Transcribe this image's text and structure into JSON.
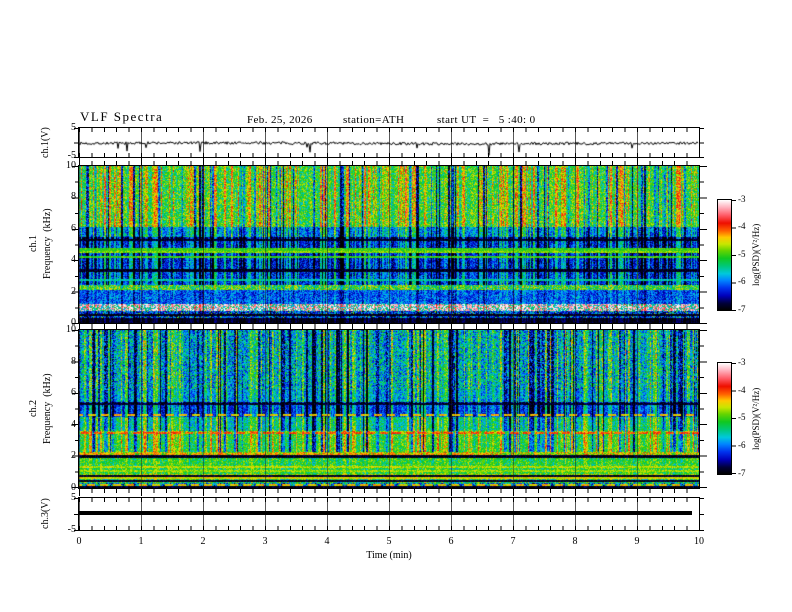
{
  "header": {
    "title": "VLF Spectra",
    "date": "Feb. 25, 2026",
    "station": "station=ATH",
    "start_ut": "start UT  =   5 :40: 0"
  },
  "x_axis": {
    "label": "Time  (min)",
    "ticks": [
      "0",
      "1",
      "2",
      "3",
      "4",
      "5",
      "6",
      "7",
      "8",
      "9",
      "10"
    ],
    "range_min": [
      0,
      10
    ]
  },
  "panels": {
    "ch1_wave": {
      "ylabel": "ch.1(V)",
      "ytick_top": "5",
      "ytick_bottom": "-5"
    },
    "spec1": {
      "channel": "ch.1",
      "ylabel": "Frequency  (kHz)",
      "yticks": [
        "10",
        "8",
        "6",
        "4",
        "2",
        "0"
      ]
    },
    "spec2": {
      "channel": "ch.2",
      "ylabel": "Frequency  (kHz)",
      "yticks": [
        "10",
        "8",
        "6",
        "4",
        "2",
        "0"
      ]
    },
    "ch3_wave": {
      "ylabel": "ch.3(V)",
      "ytick_top": "5",
      "ytick_bottom": "-5"
    }
  },
  "colorbar": {
    "label": "log(PSD)(V²/Hz)",
    "ticks": [
      "-3",
      "-4",
      "-5",
      "-6",
      "-7"
    ],
    "range": [
      -7,
      -3
    ],
    "stops": [
      [
        0.0,
        "#000000"
      ],
      [
        0.06,
        "#000038"
      ],
      [
        0.13,
        "#0000bb"
      ],
      [
        0.2,
        "#0033ee"
      ],
      [
        0.27,
        "#0086ff"
      ],
      [
        0.33,
        "#00c8dd"
      ],
      [
        0.4,
        "#00c878"
      ],
      [
        0.47,
        "#10c820"
      ],
      [
        0.54,
        "#66d400"
      ],
      [
        0.6,
        "#c8e600"
      ],
      [
        0.66,
        "#ffc800"
      ],
      [
        0.72,
        "#ff6000"
      ],
      [
        0.79,
        "#ee0f00"
      ],
      [
        0.86,
        "#ff5a66"
      ],
      [
        0.93,
        "#ffaebb"
      ],
      [
        1.0,
        "#ffffff"
      ]
    ]
  },
  "chart_data": [
    {
      "type": "line",
      "name": "ch.1 time series",
      "ylabel": "ch.1(V)",
      "ylim": [
        -5,
        5
      ],
      "xlim_min": [
        0,
        10
      ],
      "baseline_v": -0.3,
      "noise_amplitude_v": 0.9,
      "spike_amplitude_v": 4,
      "description": "continuous noisy trace near 0 V with intermittent impulsive spikes up to ±4 V"
    },
    {
      "type": "heatmap",
      "name": "ch.1 spectrogram",
      "xlabel": "Time  (min)",
      "ylabel": "Frequency  (kHz)",
      "xlim_min": [
        0,
        10
      ],
      "ylim": [
        0,
        10
      ],
      "zlabel": "log(PSD)(V²/Hz)",
      "zlim": [
        -7,
        -3
      ],
      "bands": [
        {
          "f": [
            0,
            0.35
          ],
          "psd": -6.9,
          "noise": 0.15
        },
        {
          "f": [
            0.35,
            0.78
          ],
          "psd": -6.3,
          "noise": 0.6,
          "speckle": {
            "frac": 0.1,
            "psd": -5.0
          }
        },
        {
          "f": [
            0.78,
            1.2
          ],
          "psd": -3.3,
          "noise": 0.25,
          "speckle": {
            "frac": 0.4,
            "psd": -5.5
          }
        },
        {
          "f": [
            1.2,
            2.1
          ],
          "psd": -6.1,
          "noise": 0.45
        },
        {
          "f": [
            2.1,
            2.45
          ],
          "psd": -5.1,
          "noise": 0.7
        },
        {
          "f": [
            2.45,
            3.3
          ],
          "psd": -6.3,
          "noise": 0.45
        },
        {
          "f": [
            3.3,
            5.25
          ],
          "psd": -6.4,
          "noise": 0.45
        },
        {
          "f": [
            5.25,
            5.5
          ],
          "psd": -6.8,
          "noise": 0.25
        },
        {
          "f": [
            5.5,
            6.1
          ],
          "psd": -6.0,
          "noise": 0.5
        },
        {
          "f": [
            6.1,
            10
          ],
          "psd": -5.15,
          "noise": 0.6
        }
      ],
      "hlines": [
        {
          "f": 4.2,
          "psd": -5.0
        },
        {
          "f": 4.5,
          "psd": -4.8
        },
        {
          "f": 4.68,
          "psd": -5.0
        },
        {
          "f": 3.35,
          "psd": -6.9
        },
        {
          "f": 2.75,
          "psd": -5.5
        },
        {
          "f": 5.3,
          "psd": -6.9
        },
        {
          "f": 0.5,
          "psd": -6.95
        }
      ],
      "streaks": {
        "min_f": 2.45,
        "dark_frac": 0.16,
        "dark_dpsd": -1.1,
        "bright_frac": 0.3,
        "bright_dpsd": 0.75
      }
    },
    {
      "type": "heatmap",
      "name": "ch.2 spectrogram",
      "xlabel": "Time  (min)",
      "ylabel": "Frequency  (kHz)",
      "xlim_min": [
        0,
        10
      ],
      "ylim": [
        0,
        10
      ],
      "zlabel": "log(PSD)(V²/Hz)",
      "zlim": [
        -7,
        -3
      ],
      "bands": [
        {
          "f": [
            0,
            0.12
          ],
          "psd": -6.9,
          "noise": 0.1
        },
        {
          "f": [
            0.12,
            0.3
          ],
          "psd": -5.8,
          "noise": 0.9
        },
        {
          "f": [
            0.3,
            0.55
          ],
          "psd": -5.2,
          "noise": 0.7
        },
        {
          "f": [
            0.55,
            0.9
          ],
          "psd": -4.75,
          "noise": 0.4
        },
        {
          "f": [
            0.9,
            1.9
          ],
          "psd": -5.1,
          "noise": 0.5
        },
        {
          "f": [
            1.9,
            2.05
          ],
          "psd": -6.4,
          "noise": 0.4
        },
        {
          "f": [
            2.05,
            2.25
          ],
          "psd": -4.6,
          "noise": 0.6
        },
        {
          "f": [
            2.25,
            3.4
          ],
          "psd": -5.15,
          "noise": 0.5
        },
        {
          "f": [
            3.4,
            3.6
          ],
          "psd": -4.8,
          "noise": 0.5
        },
        {
          "f": [
            3.6,
            4.5
          ],
          "psd": -5.5,
          "noise": 0.5
        },
        {
          "f": [
            4.5,
            5.25
          ],
          "psd": -6.2,
          "noise": 0.4
        },
        {
          "f": [
            5.25,
            5.45
          ],
          "psd": -6.7,
          "noise": 0.25
        },
        {
          "f": [
            5.45,
            6.2
          ],
          "psd": -5.8,
          "noise": 0.5
        },
        {
          "f": [
            6.2,
            10
          ],
          "psd": -5.7,
          "noise": 0.7
        }
      ],
      "hlines": [
        {
          "f": 3.5,
          "psd": -4.0,
          "dashed": true
        },
        {
          "f": 2.15,
          "psd": -4.25,
          "dashed": true,
          "x_end_min": 6.6
        },
        {
          "f": 4.6,
          "psd": -4.4,
          "dashed": true
        },
        {
          "f": 5.32,
          "psd": -6.85
        },
        {
          "f": 1.35,
          "psd": -4.65
        },
        {
          "f": 1.08,
          "psd": -4.7
        },
        {
          "f": 0.75,
          "psd": -6.9
        },
        {
          "f": 0.62,
          "psd": -4.5
        },
        {
          "f": 0.45,
          "psd": -6.9
        },
        {
          "f": 2.0,
          "psd": -6.9
        },
        {
          "f": 0.2,
          "psd": -4.4,
          "dashed": true
        }
      ],
      "streaks": {
        "min_f": 2.3,
        "dark_frac": 0.2,
        "dark_dpsd": -1.0,
        "bright_frac": 0.26,
        "bright_dpsd": 0.7
      }
    },
    {
      "type": "line",
      "name": "ch.3 time series",
      "ylabel": "ch.3(V)",
      "ylim": [
        -5,
        5
      ],
      "xlim_min": [
        0,
        10
      ],
      "constant_v": 0.5,
      "description": "flat thick black trace at ≈ +0.5 V for the whole interval"
    }
  ]
}
